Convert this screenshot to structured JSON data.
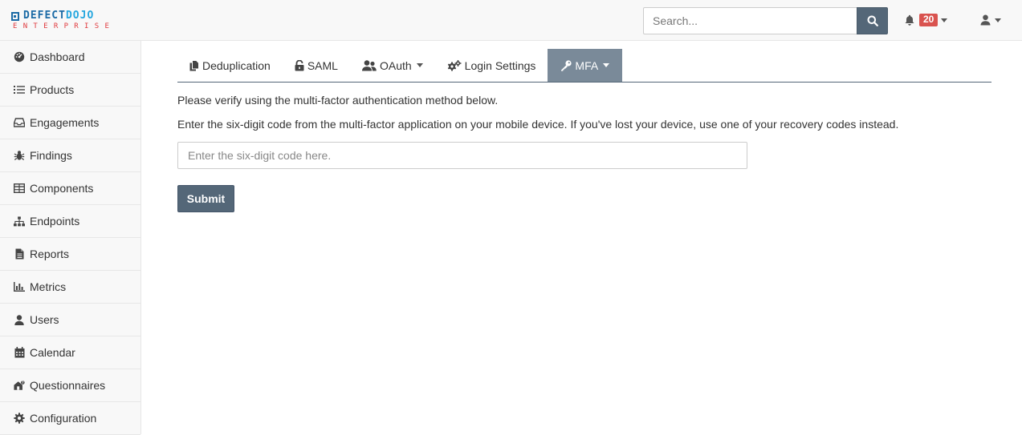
{
  "header": {
    "logo_main": "DEFECT",
    "logo_accent": "DOJO",
    "logo_sub": "ENTERPRISE",
    "search": {
      "placeholder": "Search..."
    },
    "notifications_count": "20"
  },
  "sidebar": {
    "items": [
      {
        "label": "Dashboard",
        "icon": "dashboard-icon"
      },
      {
        "label": "Products",
        "icon": "list-icon"
      },
      {
        "label": "Engagements",
        "icon": "inbox-icon"
      },
      {
        "label": "Findings",
        "icon": "bug-icon"
      },
      {
        "label": "Components",
        "icon": "table-icon"
      },
      {
        "label": "Endpoints",
        "icon": "sitemap-icon"
      },
      {
        "label": "Reports",
        "icon": "file-icon"
      },
      {
        "label": "Metrics",
        "icon": "bar-chart-icon"
      },
      {
        "label": "Users",
        "icon": "user-icon"
      },
      {
        "label": "Calendar",
        "icon": "calendar-icon"
      },
      {
        "label": "Questionnaires",
        "icon": "questionnaire-icon"
      },
      {
        "label": "Configuration",
        "icon": "gear-icon"
      }
    ]
  },
  "tabs": [
    {
      "label": "Deduplication",
      "icon": "copy-icon"
    },
    {
      "label": "SAML",
      "icon": "unlock-icon"
    },
    {
      "label": "OAuth",
      "icon": "users-icon"
    },
    {
      "label": "Login Settings",
      "icon": "gears-icon"
    },
    {
      "label": "MFA",
      "icon": "key-icon",
      "active": true
    }
  ],
  "mfa": {
    "intro": "Please verify using the multi-factor authentication method below.",
    "instructions": "Enter the six-digit code from the multi-factor application on your mobile device. If you've lost your device, use one of your recovery codes instead.",
    "code_placeholder": "Enter the six-digit code here.",
    "submit_label": "Submit"
  },
  "colors": {
    "primary": "#546778",
    "active_tab": "#7a8a99",
    "badge": "#d9534f"
  }
}
